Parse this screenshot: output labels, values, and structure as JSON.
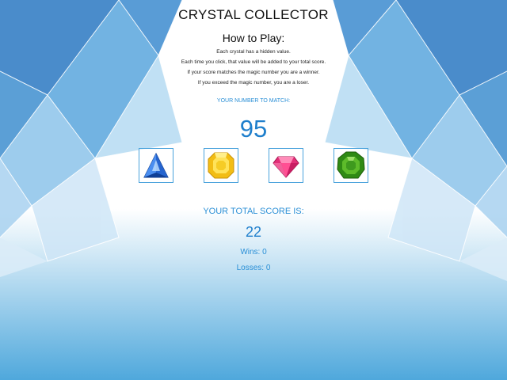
{
  "game": {
    "title": "CRYSTAL COLLECTOR",
    "how_to_heading": "How to Play:",
    "instructions": [
      "Each crystal has a hidden value.",
      "Each time you click, that value will be added to your total score.",
      "If your score matches the magic number you are a winner.",
      "If you exceed the magic number, you are a loser."
    ],
    "match_label": "YOUR NUMBER TO MATCH:",
    "target_number": "95",
    "crystals": [
      {
        "name": "blue-triangle-crystal",
        "color": "#2b6fd6"
      },
      {
        "name": "yellow-crystal",
        "color": "#f4c81e"
      },
      {
        "name": "pink-crystal",
        "color": "#e6357e"
      },
      {
        "name": "green-crystal",
        "color": "#3e9a1e"
      }
    ],
    "score_label": "YOUR TOTAL SCORE IS:",
    "total_score": "22",
    "wins_text": "Wins: 0",
    "losses_text": "Losses: 0"
  },
  "colors": {
    "accent_blue": "#2a8fd6",
    "number_blue": "#1f7fcc"
  }
}
